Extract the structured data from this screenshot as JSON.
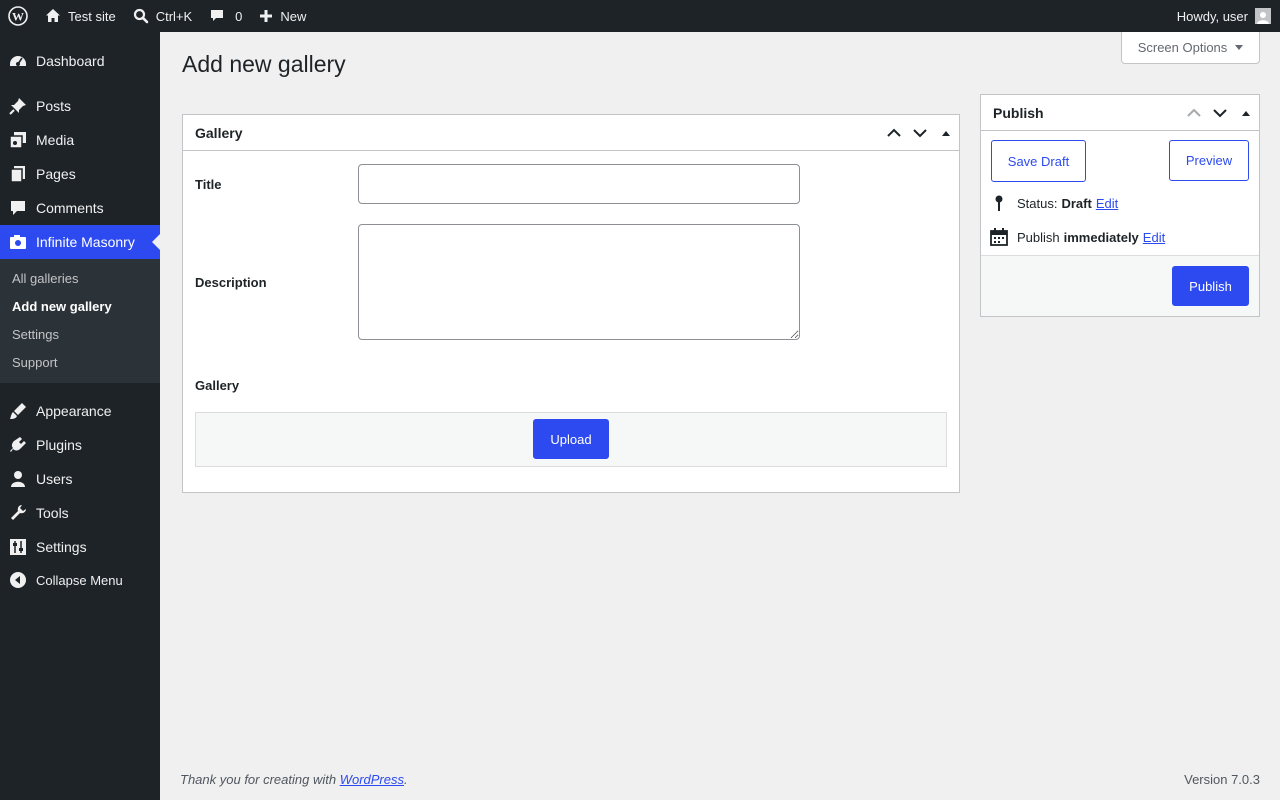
{
  "adminbar": {
    "site_name": "Test site",
    "search_shortcut": "Ctrl+K",
    "comments_count": "0",
    "new_label": "New",
    "greeting": "Howdy, user"
  },
  "sidebar": {
    "items": [
      {
        "label": "Dashboard",
        "icon": "dashboard-icon"
      },
      {
        "label": "Posts",
        "icon": "pushpin-icon"
      },
      {
        "label": "Media",
        "icon": "media-icon"
      },
      {
        "label": "Pages",
        "icon": "pages-icon"
      },
      {
        "label": "Comments",
        "icon": "comment-icon"
      },
      {
        "label": "Infinite Masonry",
        "icon": "camera-icon"
      },
      {
        "label": "Appearance",
        "icon": "brush-icon"
      },
      {
        "label": "Plugins",
        "icon": "plug-icon"
      },
      {
        "label": "Users",
        "icon": "user-icon"
      },
      {
        "label": "Tools",
        "icon": "wrench-icon"
      },
      {
        "label": "Settings",
        "icon": "sliders-icon"
      }
    ],
    "submenu": [
      "All galleries",
      "Add new gallery",
      "Settings",
      "Support"
    ],
    "collapse_label": "Collapse Menu"
  },
  "header": {
    "title": "Add new gallery",
    "screen_options": "Screen Options"
  },
  "gallery_box": {
    "title": "Gallery",
    "title_label": "Title",
    "title_value": "",
    "description_label": "Description",
    "description_value": "",
    "gallery_label": "Gallery",
    "upload_label": "Upload"
  },
  "publish_box": {
    "title": "Publish",
    "save_draft": "Save Draft",
    "preview": "Preview",
    "status_label": "Status:",
    "status_value": "Draft",
    "edit_label": "Edit",
    "publish_label": "Publish",
    "publish_when": "immediately",
    "publish_button": "Publish"
  },
  "footer": {
    "thanks_text": "Thank you for creating with",
    "link_text": "WordPress",
    "period": ".",
    "version": "Version 7.0.3"
  },
  "colors": {
    "accent": "#2c4af0",
    "sidebar_bg": "#1d2327",
    "page_bg": "#f0f0f1"
  }
}
